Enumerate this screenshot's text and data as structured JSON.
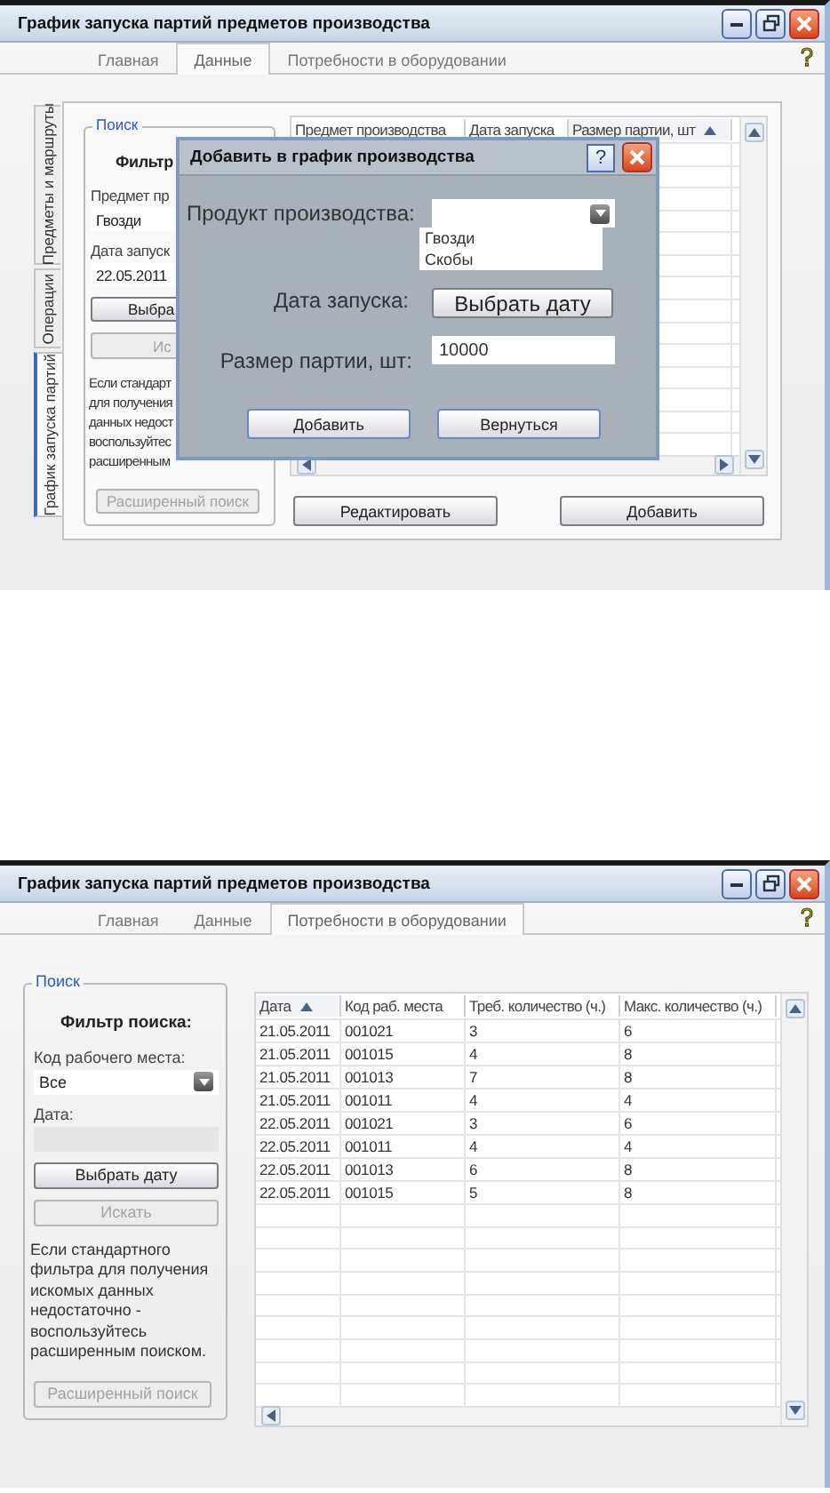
{
  "top_window": {
    "title": "График запуска партий предметов производства",
    "tabs": [
      {
        "label": "Главная",
        "selected": false
      },
      {
        "label": "Данные",
        "selected": true
      },
      {
        "label": "Потребности в оборудовании",
        "selected": false
      }
    ],
    "side_tabs": [
      {
        "label": "Предметы и маршруты",
        "selected": false
      },
      {
        "label": "Операции",
        "selected": false
      },
      {
        "label": "График запуска партий",
        "selected": true
      }
    ],
    "search": {
      "legend": "Поиск",
      "heading": "Фильтр",
      "combo_label": "Предмет пр",
      "combo_value": "Гвозди",
      "date_label": "Дата запуск",
      "date_value": "22.05.2011",
      "buttons": [
        {
          "label": "Выбра",
          "disabled": false
        },
        {
          "label": "Ис",
          "disabled": true
        }
      ],
      "hint_lines": [
        "Если стандарт",
        "для получения",
        "данных недост",
        "воспользуйтес",
        "расширенным"
      ],
      "advanced_button": {
        "label": "Расширенный поиск",
        "disabled": true
      }
    },
    "grid": {
      "columns": [
        {
          "label": "Предмет производства",
          "sorted": false
        },
        {
          "label": "Дата запуска",
          "sorted": false
        },
        {
          "label": "Размер партии, шт",
          "sorted": true
        }
      ]
    },
    "buttons": [
      "Редактировать",
      "Добавить"
    ],
    "dialog": {
      "title": "Добавить в график производства",
      "help": "?",
      "product_label": "Продукт производства:",
      "product_options": [
        {
          "label": "Гвозди",
          "selected": false
        },
        {
          "label": "Скобы",
          "selected": false
        }
      ],
      "date_label": "Дата запуска:",
      "date_button": "Выбрать дату",
      "size_label": "Размер партии, шт:",
      "size_value": "10000",
      "buttons": [
        "Добавить",
        "Вернуться"
      ]
    }
  },
  "bottom_window": {
    "title": "График запуска партий предметов производства",
    "tabs": [
      {
        "label": "Главная",
        "selected": false
      },
      {
        "label": "Данные",
        "selected": false
      },
      {
        "label": "Потребности в оборудовании",
        "selected": true
      }
    ],
    "search": {
      "legend": "Поиск",
      "heading": "Фильтр поиска:",
      "combo_label": "Код рабочего места:",
      "combo_value": "Все",
      "date_label": "Дата:",
      "buttons": [
        {
          "label": "Выбрать дату",
          "disabled": false
        },
        {
          "label": "Искать",
          "disabled": true
        }
      ],
      "hint_lines": [
        "Если стандартного",
        "фильтра для получения",
        "искомых данных",
        "недостаточно -",
        "воспользуйтесь",
        "расширенным поиском."
      ],
      "advanced_button": {
        "label": "Расширенный поиск",
        "disabled": true
      }
    },
    "grid": {
      "columns": [
        {
          "label": "Дата",
          "sorted": true
        },
        {
          "label": "Код раб. места",
          "sorted": false
        },
        {
          "label": "Треб. количество (ч.)",
          "sorted": false
        },
        {
          "label": "Макс. количество (ч.)",
          "sorted": false
        }
      ],
      "rows": [
        [
          "21.05.2011",
          "001021",
          "3",
          "6"
        ],
        [
          "21.05.2011",
          "001015",
          "4",
          "8"
        ],
        [
          "21.05.2011",
          "001013",
          "7",
          "8"
        ],
        [
          "21.05.2011",
          "001011",
          "4",
          "4"
        ],
        [
          "22.05.2011",
          "001021",
          "3",
          "6"
        ],
        [
          "22.05.2011",
          "001011",
          "4",
          "4"
        ],
        [
          "22.05.2011",
          "001013",
          "6",
          "8"
        ],
        [
          "22.05.2011",
          "001015",
          "5",
          "8"
        ]
      ]
    }
  }
}
